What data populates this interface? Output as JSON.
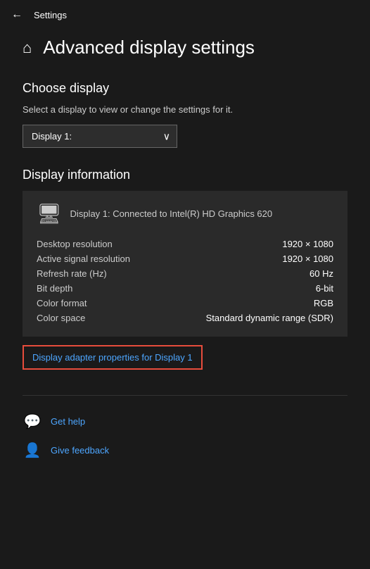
{
  "titleBar": {
    "title": "Settings",
    "backArrow": "←"
  },
  "pageHeader": {
    "homeIcon": "⌂",
    "title": "Advanced display settings"
  },
  "chooseDisplay": {
    "sectionHeader": "Choose display",
    "description": "Select a display to view or change the settings for it.",
    "dropdown": {
      "selected": "Display 1:",
      "options": [
        "Display 1:"
      ]
    }
  },
  "displayInfo": {
    "sectionHeader": "Display information",
    "monitorIcon": "🖥",
    "cardTitle": "Display 1: Connected to Intel(R) HD Graphics 620",
    "rows": [
      {
        "label": "Desktop resolution",
        "value": "1920 × 1080"
      },
      {
        "label": "Active signal resolution",
        "value": "1920 × 1080"
      },
      {
        "label": "Refresh rate (Hz)",
        "value": "60 Hz"
      },
      {
        "label": "Bit depth",
        "value": "6-bit"
      },
      {
        "label": "Color format",
        "value": "RGB"
      },
      {
        "label": "Color space",
        "value": "Standard dynamic range (SDR)"
      }
    ],
    "adapterLink": "Display adapter properties for Display 1"
  },
  "bottomLinks": [
    {
      "icon": "💬",
      "text": "Get help"
    },
    {
      "icon": "👤",
      "text": "Give feedback"
    }
  ]
}
